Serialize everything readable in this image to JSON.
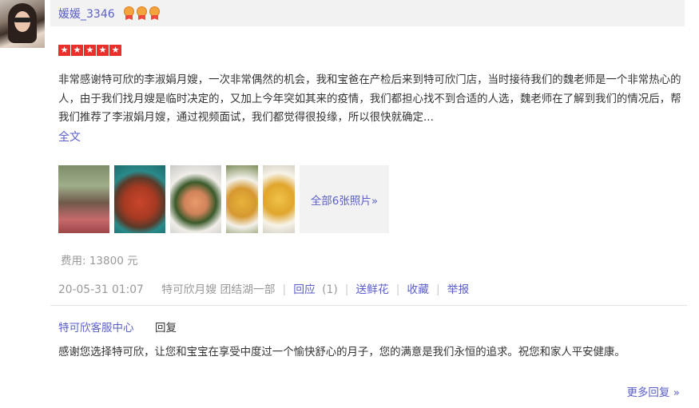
{
  "user": {
    "name": "媛媛_3346",
    "medals": [
      "medal-icon",
      "medal-icon",
      "medal-icon"
    ]
  },
  "rating": {
    "stars": 5,
    "max": 5,
    "color": "#e8302c"
  },
  "review": {
    "text": "非常感谢特可欣的李淑娟月嫂，一次非常偶然的机会，我和宝爸在产检后来到特可欣门店，当时接待我们的魏老师是一个非常热心的人，由于我们找月嫂是临时决定的，又加上今年突如其来的疫情，我们都担心找不到合适的人选，魏老师在了解到我们的情况后，帮我们推荐了李淑娟月嫂，通过视频面试，我们都觉得很投缘，所以很快就确定...",
    "full_text_link": "全文"
  },
  "photos": {
    "items": [
      "photo-woman-in-red",
      "photo-braised-meat-dish",
      "photo-shrimp-dish",
      "photo-soup-dish",
      "photo-egg-dish"
    ],
    "all_label": "全部6张照片»"
  },
  "fee": "费用: 13800 元",
  "meta": {
    "date": "20-05-31 01:07",
    "branch": "特可欣月嫂 团结湖一部",
    "reply_label": "回应",
    "reply_count": "(1)",
    "send_flower": "送鲜花",
    "collect": "收藏",
    "report": "举报"
  },
  "reply": {
    "from": "特可欣客服中心",
    "label": "回复",
    "text": "感谢您选择特可欣，让您和宝宝在享受中度过一个愉快舒心的月子，您的满意是我们永恒的追求。祝您和家人平安健康。"
  },
  "more_replies": "更多回复 »",
  "colors": {
    "link": "#5b5fc7",
    "header_bg": "#f2f2f2",
    "muted": "#999999"
  }
}
